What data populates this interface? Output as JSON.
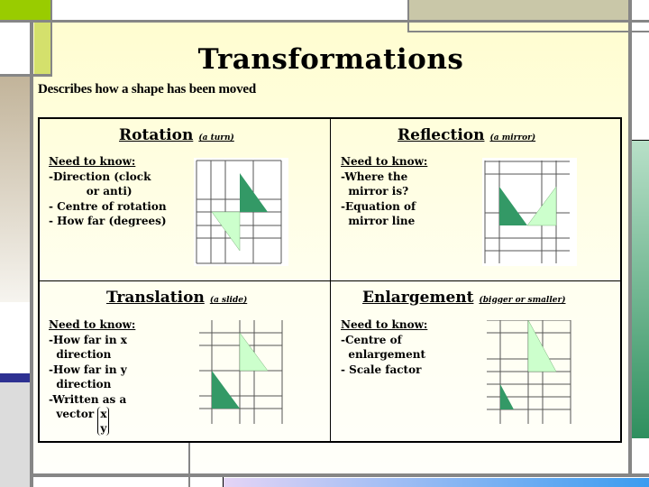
{
  "title": "Transformations",
  "subtitle": "Describes how a shape has been moved",
  "colors": {
    "dark_shape": "#339966",
    "light_shape": "#ccffcc",
    "grid_line": "#555555"
  },
  "quadrants": {
    "rotation": {
      "heading": "Rotation",
      "aside": "(a turn)",
      "need_label": "Need to know:",
      "lines": [
        "-Direction (clock",
        "          or anti)",
        "- Centre of rotation",
        "- How far (degrees)"
      ]
    },
    "reflection": {
      "heading": "Reflection",
      "aside": "(a mirror)",
      "need_label": "Need to know:",
      "lines": [
        "-Where the",
        "  mirror is?",
        "-Equation of",
        "  mirror line"
      ]
    },
    "translation": {
      "heading": "Translation",
      "aside": "(a slide)",
      "need_label": "Need to know:",
      "lines": [
        "-How far in x",
        "  direction",
        "-How far in y",
        "  direction",
        "-Written as a",
        "  vector "
      ],
      "vector": [
        "x",
        "y"
      ]
    },
    "enlargement": {
      "heading": "Enlargement",
      "aside": "(bigger or smaller)",
      "need_label": "Need to know:",
      "lines": [
        "-Centre of",
        "  enlargement",
        "- Scale factor"
      ]
    }
  }
}
